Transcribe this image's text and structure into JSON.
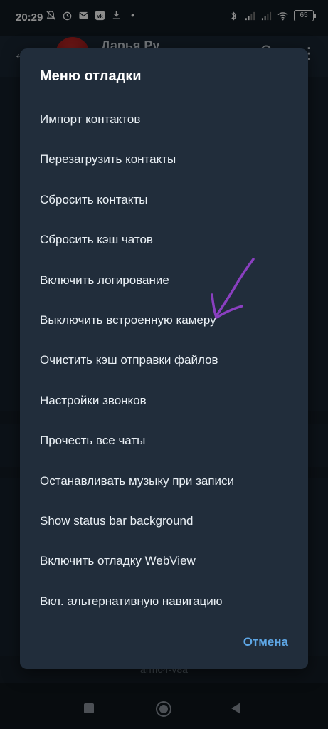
{
  "status_bar": {
    "time": "20:29",
    "battery_level": "65",
    "left_icons": [
      "bell-off-icon",
      "alarm-icon",
      "email-icon",
      "vk-icon",
      "notification-icon",
      "dot-icon"
    ],
    "right_icons": [
      "bluetooth-icon",
      "signal-icon",
      "signal-icon",
      "wifi-icon"
    ]
  },
  "app_header": {
    "contact_name": "Дарья Ру"
  },
  "dialog": {
    "title": "Меню отладки",
    "items": [
      "Импорт контактов",
      "Перезагрузить контакты",
      "Сбросить контакты",
      "Сбросить кэш чатов",
      "Включить логирование",
      "Выключить встроенную камеру",
      "Очистить кэш отправки файлов",
      "Настройки звонков",
      "Прочесть все чаты",
      "Останавливать музыку при записи",
      "Show status bar background",
      "Включить отладку WebView",
      "Вкл. альтернативную навигацию"
    ],
    "cancel_label": "Отмена"
  },
  "background": {
    "footer_text": "arm64-v8a"
  },
  "colors": {
    "dialog_bg": "#212d3b",
    "accent": "#5ea7e6",
    "annotation": "#8a3fc0"
  }
}
